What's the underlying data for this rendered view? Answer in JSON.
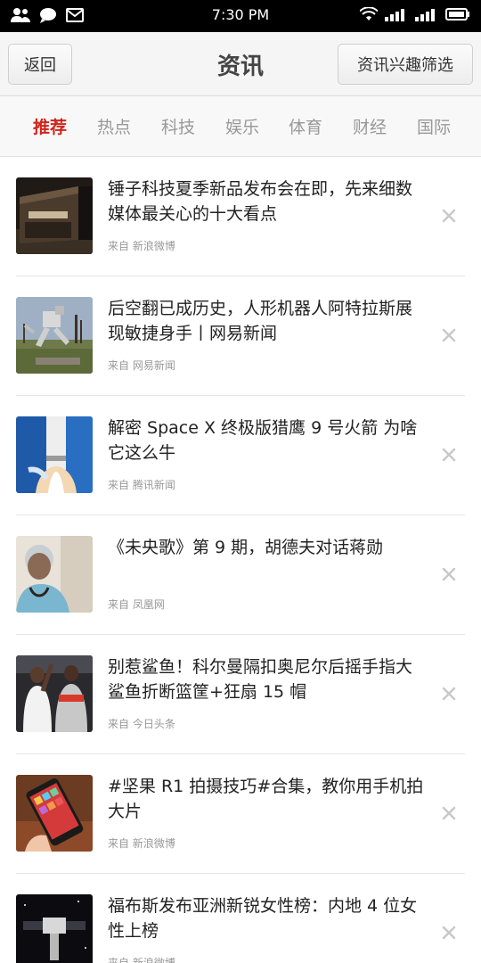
{
  "status_bar": {
    "time": "7:30 PM",
    "left_icons": [
      "contacts-icon",
      "chat-icon",
      "mail-icon"
    ],
    "right_icons": [
      "wifi-icon",
      "signal-icon",
      "signal-2-icon",
      "battery-icon"
    ]
  },
  "header": {
    "back_label": "返回",
    "title": "资讯",
    "filter_label": "资讯兴趣筛选"
  },
  "tabs": [
    {
      "label": "推荐",
      "active": true
    },
    {
      "label": "热点",
      "active": false
    },
    {
      "label": "科技",
      "active": false
    },
    {
      "label": "娱乐",
      "active": false
    },
    {
      "label": "体育",
      "active": false
    },
    {
      "label": "财经",
      "active": false
    },
    {
      "label": "国际",
      "active": false
    }
  ],
  "news": [
    {
      "title": "锤子科技夏季新品发布会在即，先来细数媒体最关心的十大看点",
      "source": "来自  新浪微博",
      "thumb": "building-photo"
    },
    {
      "title": "后空翻已成历史，人形机器人阿特拉斯展现敏捷身手丨网易新闻",
      "source": "来自  网易新闻",
      "thumb": "robot-photo"
    },
    {
      "title": "解密 Space X 终极版猎鹰 9 号火箭 为啥它这么牛",
      "source": "来自  腾讯新闻",
      "thumb": "rocket-photo"
    },
    {
      "title": "《未央歌》第 9 期，胡德夫对话蒋勋",
      "source": "来自  凤凰网",
      "thumb": "portrait-photo"
    },
    {
      "title": "别惹鲨鱼！科尔曼隔扣奥尼尔后摇手指大鲨鱼折断篮筐+狂扇 15 帽",
      "source": "来自  今日头条",
      "thumb": "basketball-photo"
    },
    {
      "title": "#坚果 R1 拍摄技巧#合集，教你用手机拍大片",
      "source": "来自  新浪微博",
      "thumb": "phone-photo"
    },
    {
      "title": "福布斯发布亚洲新锐女性榜：内地 4 位女性上榜",
      "source": "来自  新浪微博",
      "thumb": "space-photo"
    }
  ],
  "colors": {
    "accent": "#d0241c",
    "text": "#222222",
    "muted": "#999999"
  }
}
